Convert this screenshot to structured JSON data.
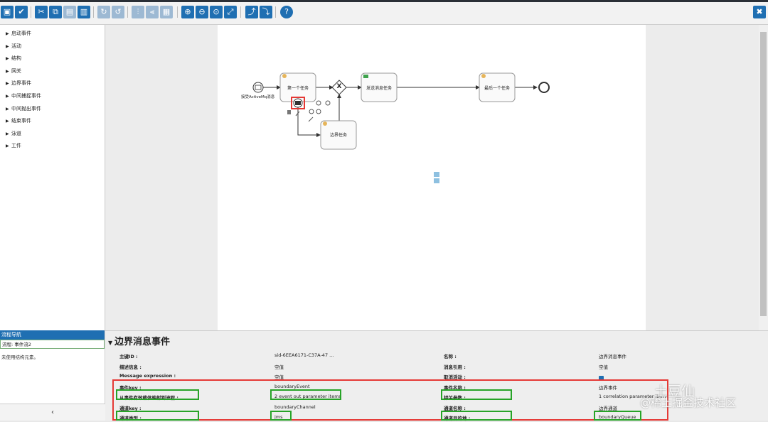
{
  "palette": {
    "toolbar_btn": "#1f6fb2",
    "nav_header": "#1f6fb2",
    "highlight_red": "#e53935",
    "highlight_green": "#27a327"
  },
  "toolbar": {
    "icons": [
      "save-icon",
      "check-icon",
      "cut-icon",
      "copy-icon",
      "paste-icon",
      "delete-icon",
      "redo-icon",
      "undo-icon",
      "align-vertical-icon",
      "align-horizontal-icon",
      "same-size-icon",
      "zoom-in-icon",
      "zoom-out-icon",
      "zoom-actual-icon",
      "zoom-fit-icon",
      "bendpoint-add-icon",
      "bendpoint-remove-icon",
      "help-icon",
      "close-icon"
    ]
  },
  "palette_tree": {
    "items": [
      "启动事件",
      "活动",
      "结构",
      "网关",
      "边界事件",
      "中间捕捉事件",
      "中间抛出事件",
      "结束事件",
      "泳道",
      "工件"
    ]
  },
  "nav_panel": {
    "header": "流程导航",
    "selected": "流程: 事件流2",
    "message": "未使用结构元素。",
    "collapse_label": "‹"
  },
  "diagram": {
    "start_label": "接受ActiveMq消息",
    "task1": "第一个任务",
    "task2": "发送消息任务",
    "task3": "最后一个任务",
    "boundary_task": "边界任务",
    "gateway_symbol": "X"
  },
  "properties": {
    "title": "边界消息事件",
    "rows": [
      {
        "k1": "主键ID :",
        "v1": "sid-6EEA6171-C37A-47 ...",
        "k2": "名称 :",
        "v2": "边界消息事件"
      },
      {
        "k1": "描述信息 :",
        "v1": "空值",
        "k2": "消息引用 :",
        "v2": "空值"
      },
      {
        "k1": "Message expression :",
        "v1": "空值",
        "k2": "取消活动 :",
        "v2": ""
      },
      {
        "k1": "事件key :",
        "v1": "boundaryEvent",
        "k2": "事件名称 :",
        "v2": "边界事件"
      },
      {
        "k1": "从事件有效载体映射到流程 :",
        "v1": "2 event out parameter items",
        "k2": "相关参数 :",
        "v2": "1 correlation parameter items"
      },
      {
        "k1": "通道key :",
        "v1": "boundaryChannel",
        "k2": "通道名称 :",
        "v2": "边界通道"
      },
      {
        "k1": "通道类型 :",
        "v1": "jms",
        "k2": "通道目的地 :",
        "v2": "boundaryQueue"
      }
    ]
  },
  "watermark": {
    "line1": "土豆仙",
    "line2": "@稀土掘金技术社区"
  }
}
